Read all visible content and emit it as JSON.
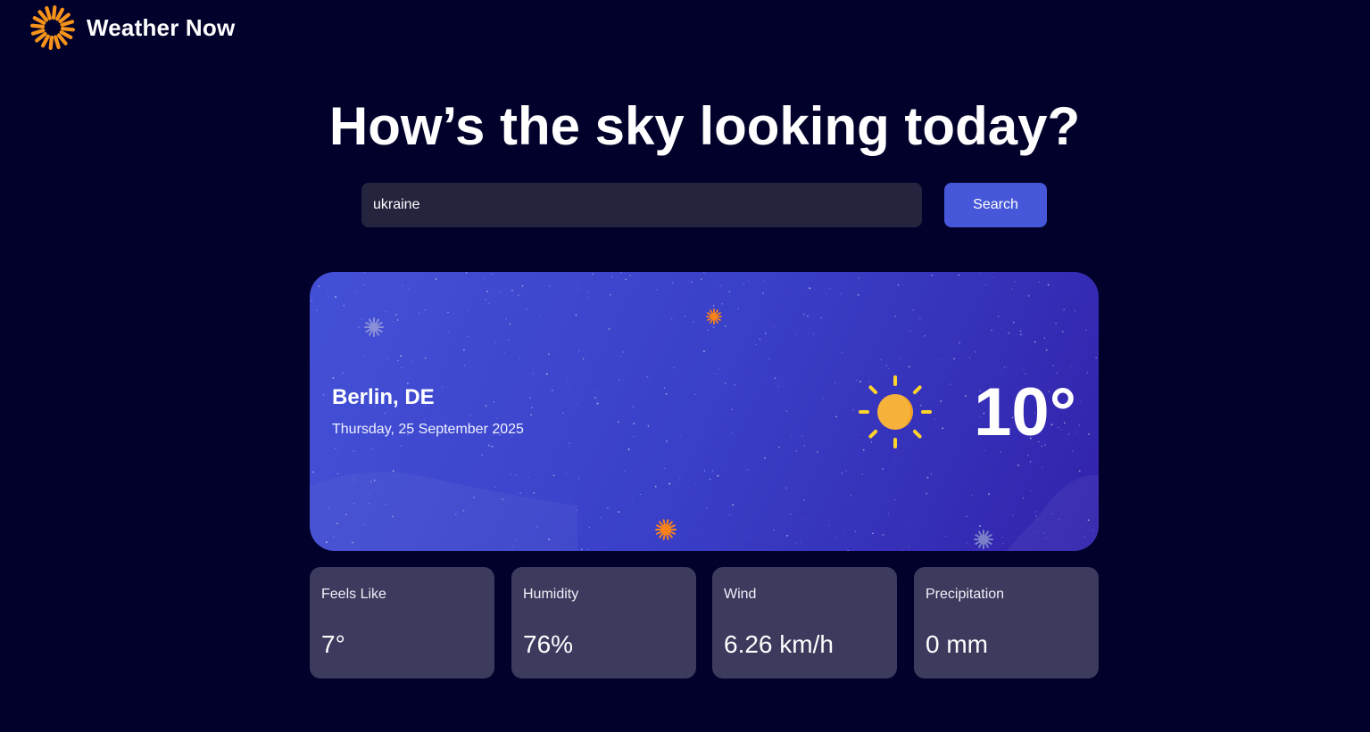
{
  "app": {
    "title": "Weather Now",
    "logo_icon": "sun-logo-icon",
    "accent_color": "#f7931a"
  },
  "headline": "How’s the sky looking today?",
  "search": {
    "value": "ukraine",
    "button_label": "Search",
    "button_color": "#4658d9"
  },
  "current": {
    "location": "Berlin, DE",
    "date": "Thursday, 25 September 2025",
    "temperature": "10°",
    "condition_icon": "sunny-icon"
  },
  "stats": [
    {
      "label": "Feels Like",
      "value": "7°"
    },
    {
      "label": "Humidity",
      "value": "76%"
    },
    {
      "label": "Wind",
      "value": "6.26 km/h"
    },
    {
      "label": "Precipitation",
      "value": "0 mm"
    }
  ]
}
